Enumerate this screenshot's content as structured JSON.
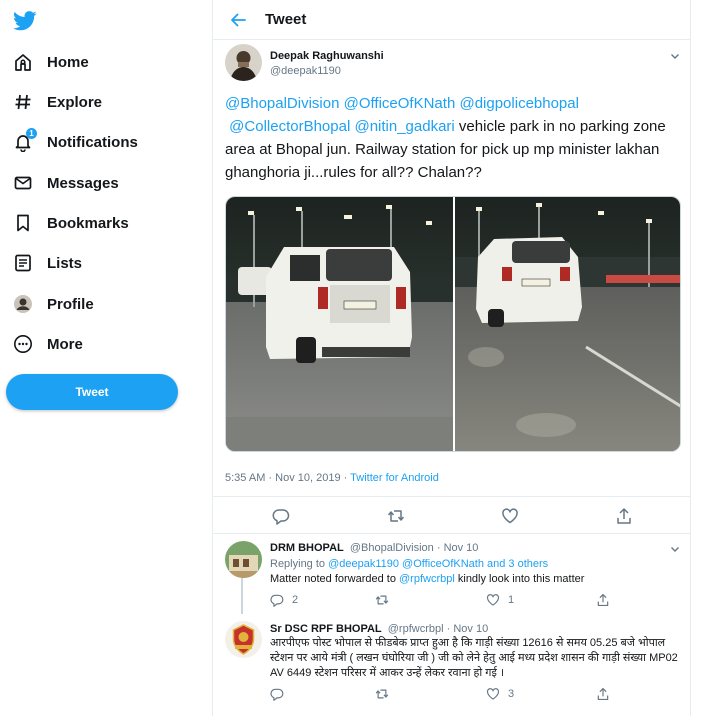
{
  "sidebar": {
    "items": [
      {
        "label": "Home",
        "icon": "home-icon"
      },
      {
        "label": "Explore",
        "icon": "hashtag-icon"
      },
      {
        "label": "Notifications",
        "icon": "bell-icon",
        "badge": "1"
      },
      {
        "label": "Messages",
        "icon": "envelope-icon"
      },
      {
        "label": "Bookmarks",
        "icon": "bookmark-icon"
      },
      {
        "label": "Lists",
        "icon": "list-icon"
      },
      {
        "label": "Profile",
        "icon": "avatar-icon"
      },
      {
        "label": "More",
        "icon": "more-icon"
      }
    ],
    "tweet_label": "Tweet"
  },
  "header": {
    "title": "Tweet"
  },
  "tweet": {
    "name": "Deepak Raghuwanshi",
    "handle": "@deepak1190",
    "mentions": [
      "@BhopalDivision",
      "@OfficeOfKNath",
      "@digpolicebhopal",
      "@CollectorBhopal",
      "@nitin_gadkari"
    ],
    "text": " vehicle park in no parking zone area at Bhopal jun. Railway station for pick up mp minister lakhan ghanghoria  ji...rules for all?? Chalan??",
    "time": "5:35 AM · Nov 10, 2019 · ",
    "source": "Twitter for Android"
  },
  "replies": [
    {
      "name": "DRM BHOPAL",
      "handle": "@BhopalDivision · Nov 10",
      "replying_prefix": "Replying to ",
      "replying_to": "@deepak1190 @OfficeOfKNath and 3 others",
      "text_before": "Matter noted forwarded to ",
      "text_mention": "@rpfwcrbpl",
      "text_after": " kindly look into this matter",
      "reply_count": "2",
      "retweet_count": "",
      "like_count": "1"
    },
    {
      "name": "Sr DSC RPF BHOPAL",
      "handle": "@rpfwcrbpl · Nov 10",
      "text": "आरपीएफ पोस्ट भोपाल से फीडबेक प्राप्त हुआ है कि गाड़ी संख्या 12616 से समय 05.25 बजे भोपाल स्टेशन पर आये  मंत्री  ( लखन घंघोरिया जी ) जी को लेने हेतु आई  मध्य प्रदेश शासन की गाड़ी संख्या  MP02 AV 6449  स्टेशन परिसर में आकर उन्हें लेकर रवाना हो गई ।",
      "like_count": "3"
    }
  ],
  "colors": {
    "accent": "#1da1f2",
    "text": "#14171a",
    "secondary": "#657786",
    "border": "#e6ecf0"
  }
}
